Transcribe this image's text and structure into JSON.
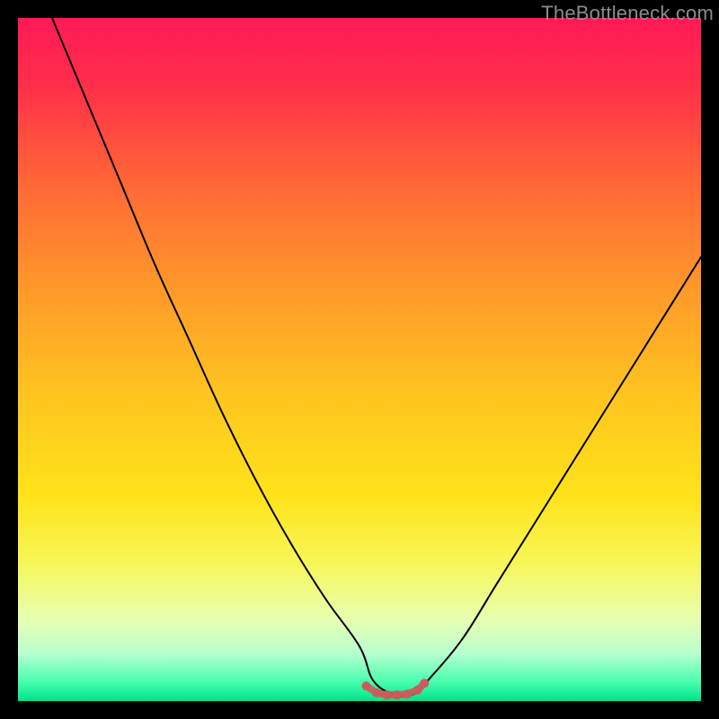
{
  "watermark": "TheBottleneck.com",
  "chart_data": {
    "type": "line",
    "title": "",
    "xlabel": "",
    "ylabel": "",
    "xlim": [
      0,
      100
    ],
    "ylim": [
      0,
      100
    ],
    "series": [
      {
        "name": "bottleneck-curve",
        "x": [
          5,
          10,
          15,
          20,
          25,
          30,
          35,
          40,
          45,
          50,
          52,
          55,
          58,
          60,
          65,
          70,
          75,
          80,
          85,
          90,
          95,
          100
        ],
        "y": [
          100,
          88,
          76,
          64,
          53,
          42,
          32,
          23,
          15,
          8,
          3,
          1,
          1,
          3,
          9,
          17,
          25,
          33,
          41,
          49,
          57,
          65
        ]
      }
    ],
    "markers": {
      "name": "flat-region-markers",
      "x": [
        51,
        52.5,
        54,
        55.5,
        57,
        58.5,
        59.5
      ],
      "y": [
        2.2,
        1.2,
        0.9,
        0.9,
        1.0,
        1.6,
        2.6
      ]
    },
    "gradient_stops": [
      {
        "offset": 0.0,
        "color": "#ff1a55"
      },
      {
        "offset": 0.1,
        "color": "#ff2f4a"
      },
      {
        "offset": 0.25,
        "color": "#ff6a35"
      },
      {
        "offset": 0.4,
        "color": "#ff9a2a"
      },
      {
        "offset": 0.55,
        "color": "#ffc41f"
      },
      {
        "offset": 0.7,
        "color": "#ffe31a"
      },
      {
        "offset": 0.8,
        "color": "#f7f75a"
      },
      {
        "offset": 0.88,
        "color": "#e8ffb0"
      },
      {
        "offset": 0.93,
        "color": "#b8ffd0"
      },
      {
        "offset": 0.97,
        "color": "#4dffb0"
      },
      {
        "offset": 1.0,
        "color": "#00e38a"
      }
    ]
  }
}
